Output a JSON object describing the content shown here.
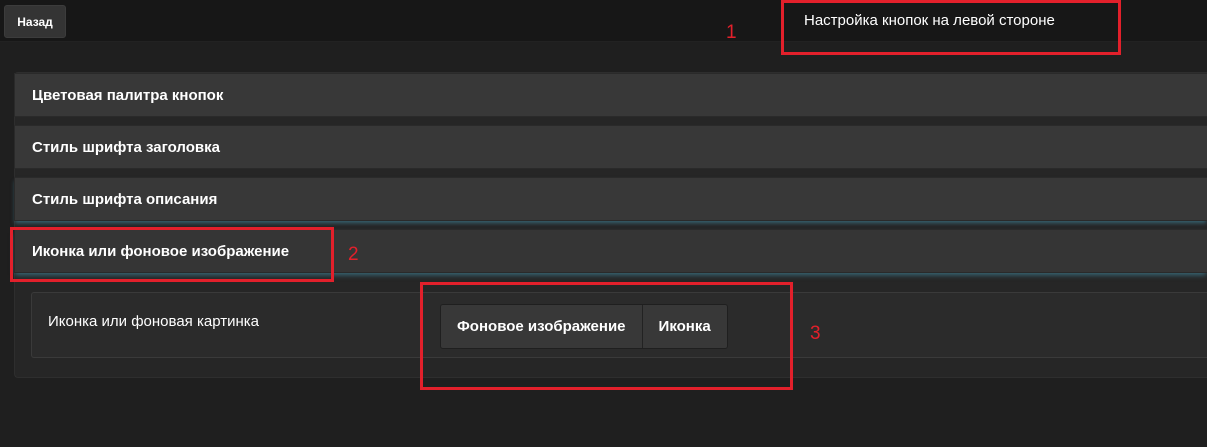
{
  "topbar": {
    "back_label": "Назад",
    "title": "Настройка кнопок на левой стороне"
  },
  "accordion": {
    "sections": [
      {
        "label": "Цветовая палитра кнопок"
      },
      {
        "label": "Стиль шрифта заголовка"
      },
      {
        "label": "Стиль шрифта описания"
      },
      {
        "label": "Иконка или фоновое изображение"
      }
    ]
  },
  "icon_setting": {
    "label": "Иконка или фоновая картинка",
    "options": [
      "Фоновое изображение",
      "Иконка"
    ]
  },
  "annotations": {
    "numbers": [
      "1",
      "2",
      "3"
    ],
    "color": "#e2202b"
  },
  "colors": {
    "background": "#1f1f1f",
    "topbar": "#171717",
    "panel": "#262626",
    "header": "#383838",
    "active_glow": "#4696af"
  }
}
